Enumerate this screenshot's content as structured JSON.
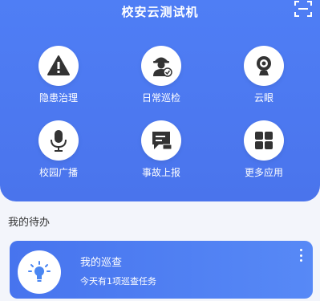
{
  "header": {
    "title": "校安云测试机",
    "scan_icon": "scan-qr-icon",
    "background_color": "#4f7ef5"
  },
  "grid": {
    "items": [
      {
        "label": "隐患治理",
        "icon": "warning-icon"
      },
      {
        "label": "日常巡检",
        "icon": "inspector-icon"
      },
      {
        "label": "云眼",
        "icon": "webcam-icon"
      },
      {
        "label": "校园广播",
        "icon": "microphone-icon"
      },
      {
        "label": "事故上报",
        "icon": "report-icon"
      },
      {
        "label": "更多应用",
        "icon": "apps-grid-icon"
      }
    ]
  },
  "todo": {
    "section_title": "我的待办",
    "card": {
      "title": "我的巡查",
      "subtitle": "今天有1项巡查任务",
      "icon": "lightbulb-icon",
      "accent_color": "#4774ee"
    }
  }
}
